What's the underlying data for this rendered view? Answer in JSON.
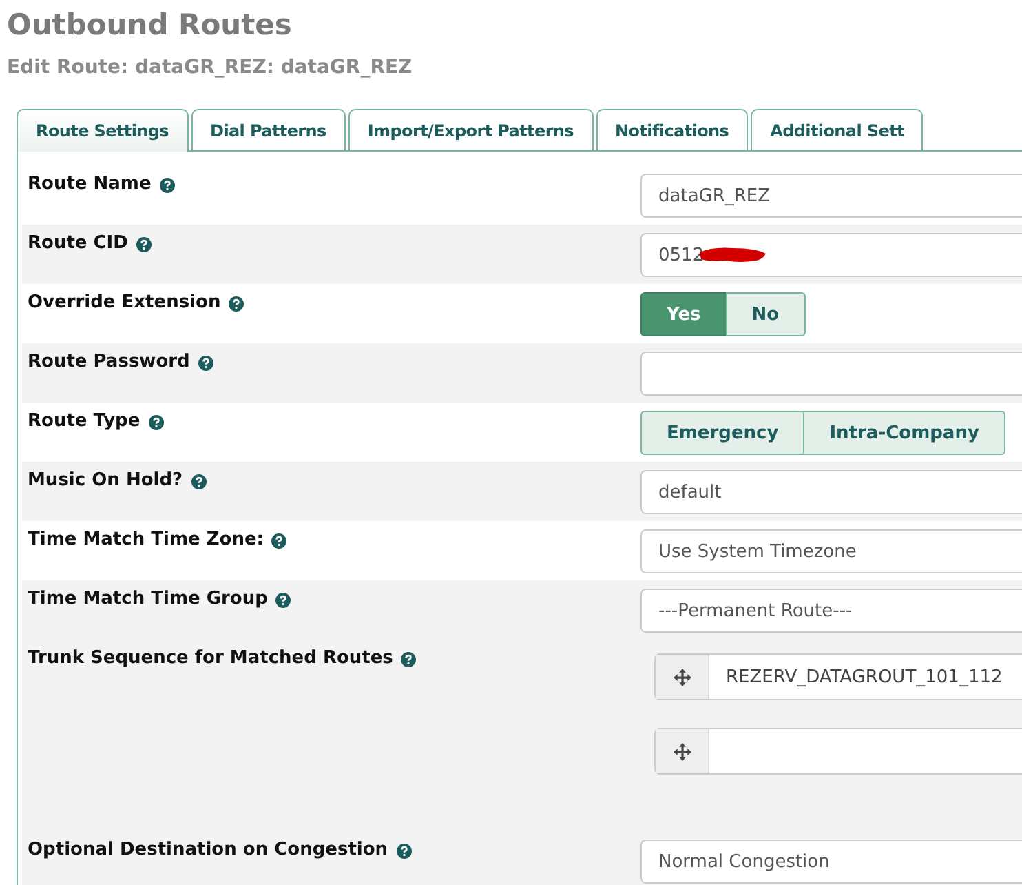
{
  "page_title": "Outbound Routes",
  "subtitle": "Edit Route: dataGR_REZ: dataGR_REZ",
  "tabs": [
    {
      "label": "Route Settings",
      "selected": true
    },
    {
      "label": "Dial Patterns",
      "selected": false
    },
    {
      "label": "Import/Export Patterns",
      "selected": false
    },
    {
      "label": "Notifications",
      "selected": false
    },
    {
      "label": "Additional Sett",
      "selected": false
    }
  ],
  "rows": [
    {
      "kind": "input",
      "label": "Route Name",
      "value": "dataGR_REZ"
    },
    {
      "kind": "input",
      "label": "Route CID",
      "value": "0512",
      "redacted": true
    },
    {
      "kind": "toggle",
      "label": "Override Extension",
      "options": [
        {
          "label": "Yes",
          "selected": true
        },
        {
          "label": "No",
          "selected": false
        }
      ]
    },
    {
      "kind": "input",
      "label": "Route Password"
    },
    {
      "kind": "toggle",
      "label": "Route Type",
      "options": [
        {
          "label": "Emergency",
          "selected": false
        },
        {
          "label": "Intra-Company",
          "selected": false
        }
      ]
    },
    {
      "kind": "select",
      "label": "Music On Hold?",
      "value": "default"
    },
    {
      "kind": "select",
      "label": "Time Match Time Zone:",
      "value": "Use System Timezone"
    },
    {
      "kind": "select",
      "label": "Time Match Time Group",
      "value": "---Permanent Route---"
    },
    {
      "kind": "trunks",
      "label": "Trunk Sequence for Matched Routes",
      "trunks": [
        {
          "kind": "filled",
          "value": "REZERV_DATAGROUT_101_112"
        },
        {
          "kind": "empty"
        }
      ]
    },
    {
      "kind": "select",
      "label": "Optional Destination on Congestion",
      "value": "Normal Congestion"
    }
  ]
}
